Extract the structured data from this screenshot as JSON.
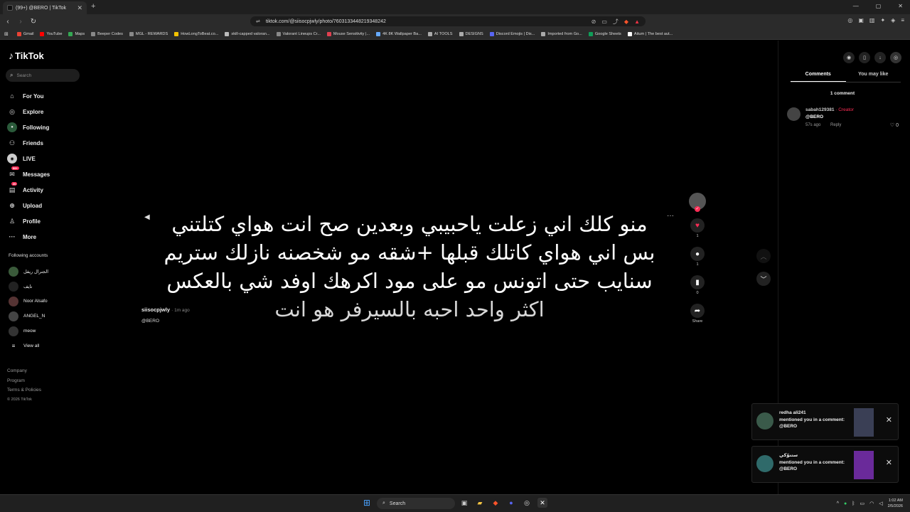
{
  "browser": {
    "tab_title": "(99+) @BERO | TikTok",
    "url": "tiktok.com/@siisocpjwly/photo/7603133448219348242",
    "bookmarks": [
      {
        "label": "Gmail",
        "color": "#ea4335"
      },
      {
        "label": "YouTube",
        "color": "#ff0000"
      },
      {
        "label": "Maps",
        "color": "#34a853"
      },
      {
        "label": "Beeper Codes",
        "color": "#888888"
      },
      {
        "label": "MGL - REWARDS",
        "color": "#888888"
      },
      {
        "label": "HowLongToBeat.co...",
        "color": "#f2c200"
      },
      {
        "label": "skill-capped valoran...",
        "color": "#bbbbbb"
      },
      {
        "label": "Valorant Lineups Cr...",
        "color": "#888888"
      },
      {
        "label": "Mouse Sensitivity |...",
        "color": "#e04050"
      },
      {
        "label": "4K 8K Wallpaper Ba...",
        "color": "#66aaff"
      },
      {
        "label": "AI TOOLS",
        "color": "#aaaaaa"
      },
      {
        "label": "DESIGNS",
        "color": "#aaaaaa"
      },
      {
        "label": "Discord Emojis | Dis...",
        "color": "#5865f2"
      },
      {
        "label": "Imported from Go...",
        "color": "#aaaaaa"
      },
      {
        "label": "Google Sheets",
        "color": "#0f9d58"
      },
      {
        "label": "Aitum | The best aut...",
        "color": "#ffffff"
      }
    ]
  },
  "sidebar": {
    "logo": "TikTok",
    "search_placeholder": "Search",
    "nav": [
      {
        "label": "For You",
        "icon": "home-icon"
      },
      {
        "label": "Explore",
        "icon": "compass-icon"
      },
      {
        "label": "Following",
        "icon": "following-icon"
      },
      {
        "label": "Friends",
        "icon": "friends-icon"
      },
      {
        "label": "LIVE",
        "icon": "live-icon"
      },
      {
        "label": "Messages",
        "icon": "messages-icon",
        "badge": "99+"
      },
      {
        "label": "Activity",
        "icon": "activity-icon",
        "badge": "20"
      },
      {
        "label": "Upload",
        "icon": "upload-icon"
      },
      {
        "label": "Profile",
        "icon": "profile-icon"
      },
      {
        "label": "More",
        "icon": "more-icon"
      }
    ],
    "following_heading": "Following accounts",
    "following": [
      "الجنرال ريفل",
      "نايف",
      "Noor Alsafo",
      "ANGEL_N",
      "meow",
      "View all"
    ],
    "footer": [
      "Company",
      "Program",
      "Terms & Policies"
    ],
    "copyright": "© 2026 TikTok"
  },
  "post": {
    "caption_lines": [
      "منو كلك اني زعلت ياحبيبي وبعدين صح انت هواي كتلتني",
      "بس اني هواي كاتلك قبلها +شقه مو شخصنه نازلك ستريم",
      "سنايب حتى اتونس مو على مود اكرهك اوفد شي بالعكس",
      "اكثر واحد احبه بالسيرفر هو انت"
    ],
    "author": "siisocpjwly",
    "time_ago": "· 1m ago",
    "mention": "@BERO",
    "likes": "1",
    "comments": "1",
    "saves": "0",
    "share_label": "Share"
  },
  "right_panel": {
    "tabs": [
      "Comments",
      "You may like"
    ],
    "comment_count": "1 comment",
    "comment": {
      "user": "sabah129381",
      "creator_tag": "· Creator",
      "text": "@BERO",
      "time": "57s ago",
      "reply": "Reply",
      "likes": "0"
    }
  },
  "notifications": [
    {
      "user": "redha ali241",
      "message": "mentioned you in a comment: @BERO",
      "thumb_color": "#3a3f55",
      "avatar_color": "#3a5a4a"
    },
    {
      "user": "ستنوّكي",
      "message": "mentioned you in a comment: @BERO",
      "thumb_color": "#6a2a9a",
      "avatar_color": "#2f6a6a"
    }
  ],
  "taskbar": {
    "search_label": "Search",
    "time": "1:02 AM",
    "date": "2/5/2026"
  }
}
